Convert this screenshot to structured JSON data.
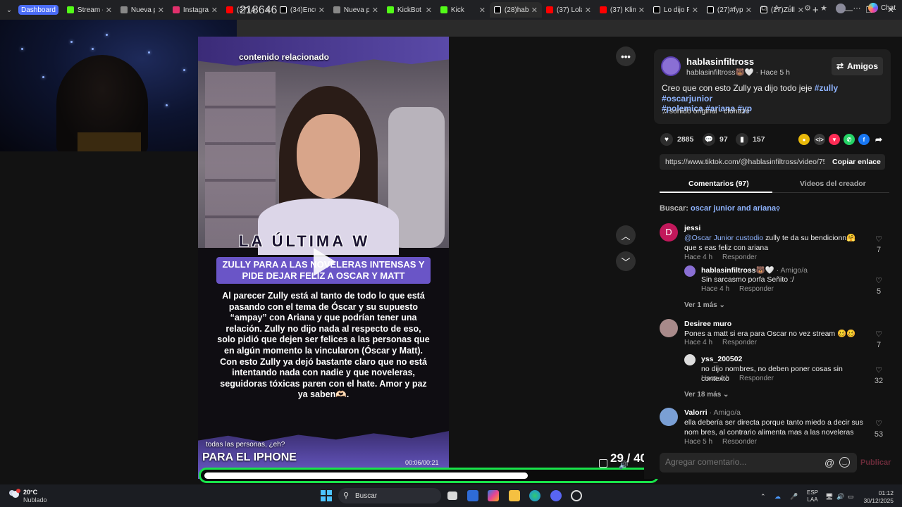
{
  "browser": {
    "tabs": [
      {
        "label": "Dashboard",
        "color": "#4a6cf7"
      },
      {
        "label": "Stream - K",
        "color": "#53fc18"
      },
      {
        "label": "Nueva pe",
        "color": "#888888"
      },
      {
        "label": "Instagram",
        "color": "#e1306c"
      },
      {
        "label": "(37) A",
        "color": "#ff0000"
      },
      {
        "label": "(34)Encue",
        "color": "#ffffff"
      },
      {
        "label": "Nueva pe",
        "color": "#888888"
      },
      {
        "label": "KickBot - K",
        "color": "#53fc18"
      },
      {
        "label": "Kick",
        "color": "#53fc18"
      },
      {
        "label": "(28)hablas",
        "color": "#ffffff"
      },
      {
        "label": "(37) Lola-",
        "color": "#ff0000"
      },
      {
        "label": "(37) Klim",
        "color": "#ff0000"
      },
      {
        "label": "Lo dijo Fe",
        "color": "#ffffff"
      },
      {
        "label": "(27)#fyp",
        "color": "#ffffff"
      },
      {
        "label": "(27)Zully",
        "color": "#ffffff"
      }
    ],
    "new_tab": "+",
    "address_fragment": "218646",
    "chat_label": "Chat"
  },
  "video": {
    "related_label": "contenido relacionado",
    "title_overlay": "LA ÚLTIMA W",
    "headline": "ZULLY PARA A LAS NOVELERAS INTENSAS Y PIDE DEJAR FELIZ A OSCAR Y MATT",
    "article": "Al parecer Zully  está al tanto de todo lo que está pasando con el tema de Óscar y su supuesto “ampay” con Ariana y que podrían tener una relación. Zully no dijo nada al respecto de eso, solo pidió que dejen ser felices a las personas que en algún momento la vincularon (Óscar y Matt). Con esto Zully ya dejó bastante claro que no está intentando nada con nadie y que noveleras, seguidoras tóxicas paren con el hate. Amor y paz ya saben🫶🏻.",
    "caption_small": "todas las personas, ¿eh?",
    "caption_big": "PARA EL IPHONE",
    "timecode": "00:06/00:21",
    "progress": 0.72,
    "counter": "29 / 40"
  },
  "post": {
    "author": "hablasinfiltross",
    "author_sub": "hablasinfiltross🐻🤍 · Hace 5 h",
    "friends_label": "Amigos",
    "desc_text": "Creo que con esto Zully ya dijo todo jeje ",
    "hashtags_line1": "#zully #oscarjunior",
    "hashtags_line2": "#polemica #ariana #yp",
    "sound": "sonido original - cfohaze",
    "likes": "2885",
    "comments": "97",
    "saves": "157",
    "link": "https://www.tiktok.com/@hablasinfiltross/video/75...",
    "copy_label": "Copiar enlace",
    "tab_comments": "Comentarios (97)",
    "tab_creator": "Videos del creador",
    "search_prefix": "Buscar: ",
    "search_query": "oscar junior and ariana"
  },
  "comments": [
    {
      "name": "jessi",
      "mention": "@Oscar Junior custodio",
      "text": " zully te da su bendicionn🤗 que s eas feliz con ariana",
      "time": "Hace 4 h",
      "reply": "Responder",
      "likes": "7",
      "avatar_letter": "D",
      "avatar_color": "#c2185b"
    },
    {
      "name": "hablasinfiltross🐻🤍",
      "tag": " · Amigo/a",
      "text": "Sin sarcasmo porfa Señito :/",
      "time": "Hace 4 h",
      "reply": "Responder",
      "likes": "5",
      "avatar_color": "#8a6fd4"
    },
    {
      "more": "Ver 1 más"
    },
    {
      "name": "Desiree muro",
      "text": "Pones a matt si era para Oscar no vez stream 🥴🥴",
      "time": "Hace 4 h",
      "reply": "Responder",
      "likes": "7",
      "avatar_color": "#a88a8a"
    },
    {
      "name": "yss_200502",
      "text": "no dijo nombres, no deben poner cosas sin contexto",
      "time": "Hace 4 h",
      "reply": "Responder",
      "likes": "32",
      "avatar_color": "#dddddd"
    },
    {
      "more": "Ver 18 más"
    },
    {
      "name": "Valorri",
      "tag": " · Amigo/a",
      "text": "ella debería ser directa porque tanto miedo a decir sus nom bres, al contrario alimenta mas a las noveleras",
      "time": "Hace 5 h",
      "reply": "Responder",
      "likes": "53",
      "avatar_color": "#7a9fd4"
    }
  ],
  "composer": {
    "placeholder": "Agregar comentario...",
    "publish": "Publicar"
  },
  "taskbar": {
    "temp": "20°C",
    "weather": "Nublado",
    "search": "Buscar",
    "lang1": "ESP",
    "lang2": "LAA",
    "time": "01:12",
    "date": "30/12/2025"
  }
}
